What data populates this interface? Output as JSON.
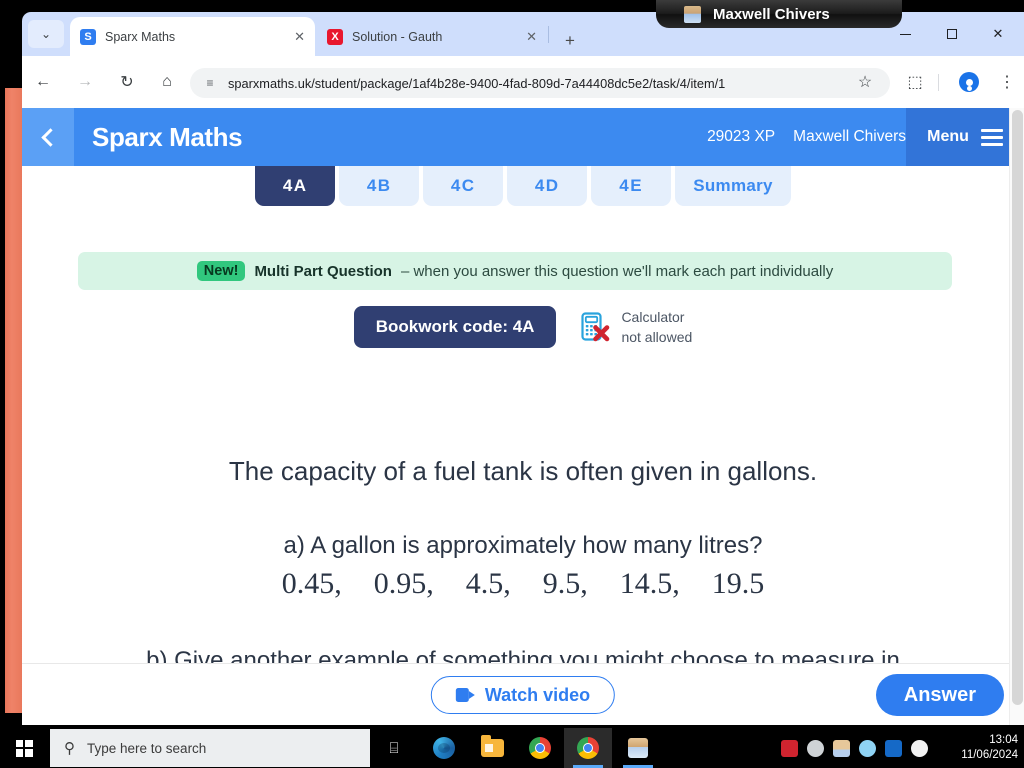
{
  "browser": {
    "tabs": [
      {
        "title": "Sparx Maths",
        "favicon_letter": "S",
        "favicon_name": "sparx-favicon",
        "active": true,
        "close_glyph": "✕"
      },
      {
        "title": "Solution - Gauth",
        "favicon_letter": "X",
        "favicon_name": "gauth-favicon",
        "active": false,
        "close_glyph": "✕"
      }
    ],
    "new_tab_glyph": "+",
    "tab_list_glyph": "⌄",
    "window_controls": {
      "minimize": "–",
      "maximize": "□",
      "close": "✕"
    },
    "toolbar": {
      "back_glyph": "←",
      "forward_glyph": "→",
      "reload_glyph": "↻",
      "home_glyph": "⌂",
      "site_info_glyph": "≡",
      "url": "sparxmaths.uk/student/package/1af4b28e-9400-4fad-809d-7a44408dc5e2/task/4/item/1",
      "bookmark_glyph": "☆",
      "extensions_glyph": "⬚",
      "menu_glyph": "⋮"
    }
  },
  "overlay_tile": {
    "name": "Maxwell Chivers"
  },
  "app": {
    "header": {
      "back_label": "Back",
      "logo": "Sparx Maths",
      "xp": "29023 XP",
      "user": "Maxwell Chivers",
      "menu_label": "Menu"
    },
    "subtabs": [
      {
        "label": "4A",
        "active": true
      },
      {
        "label": "4B",
        "active": false
      },
      {
        "label": "4C",
        "active": false
      },
      {
        "label": "4D",
        "active": false
      },
      {
        "label": "4E",
        "active": false
      },
      {
        "label": "Summary",
        "active": false
      }
    ],
    "banner": {
      "badge": "New!",
      "strong": "Multi Part Question",
      "text": "– when you answer this question we'll mark each part individually"
    },
    "bookwork": {
      "code_label": "Bookwork code: 4A",
      "calculator_line1": "Calculator",
      "calculator_line2": "not allowed"
    },
    "question": {
      "intro": "The capacity of a fuel tank is often given in gallons.",
      "part_a": "a) A gallon is approximately how many litres?",
      "options": [
        "0.45,",
        "0.95,",
        "4.5,",
        "9.5,",
        "14.5,",
        "19.5"
      ],
      "part_b": "b) Give another example of something you might choose to measure in gallons instead of litres."
    },
    "footer": {
      "watch_video": "Watch video",
      "answer": "Answer"
    }
  },
  "taskbar": {
    "search_placeholder": "Type here to search",
    "task_view_glyph": "⌸",
    "apps": [
      {
        "name": "edge"
      },
      {
        "name": "file-explorer"
      },
      {
        "name": "chrome-alt"
      },
      {
        "name": "chrome"
      },
      {
        "name": "user-app"
      }
    ],
    "time": "13:04",
    "date": "11/06/2024"
  },
  "colors": {
    "brand_blue": "#3c8af0",
    "deep_navy": "#303f72",
    "banner_green": "#d7f4e5",
    "badge_green": "#31c77e",
    "accent_blue": "#2f7df0",
    "orange_strip": "#ec7f63"
  }
}
